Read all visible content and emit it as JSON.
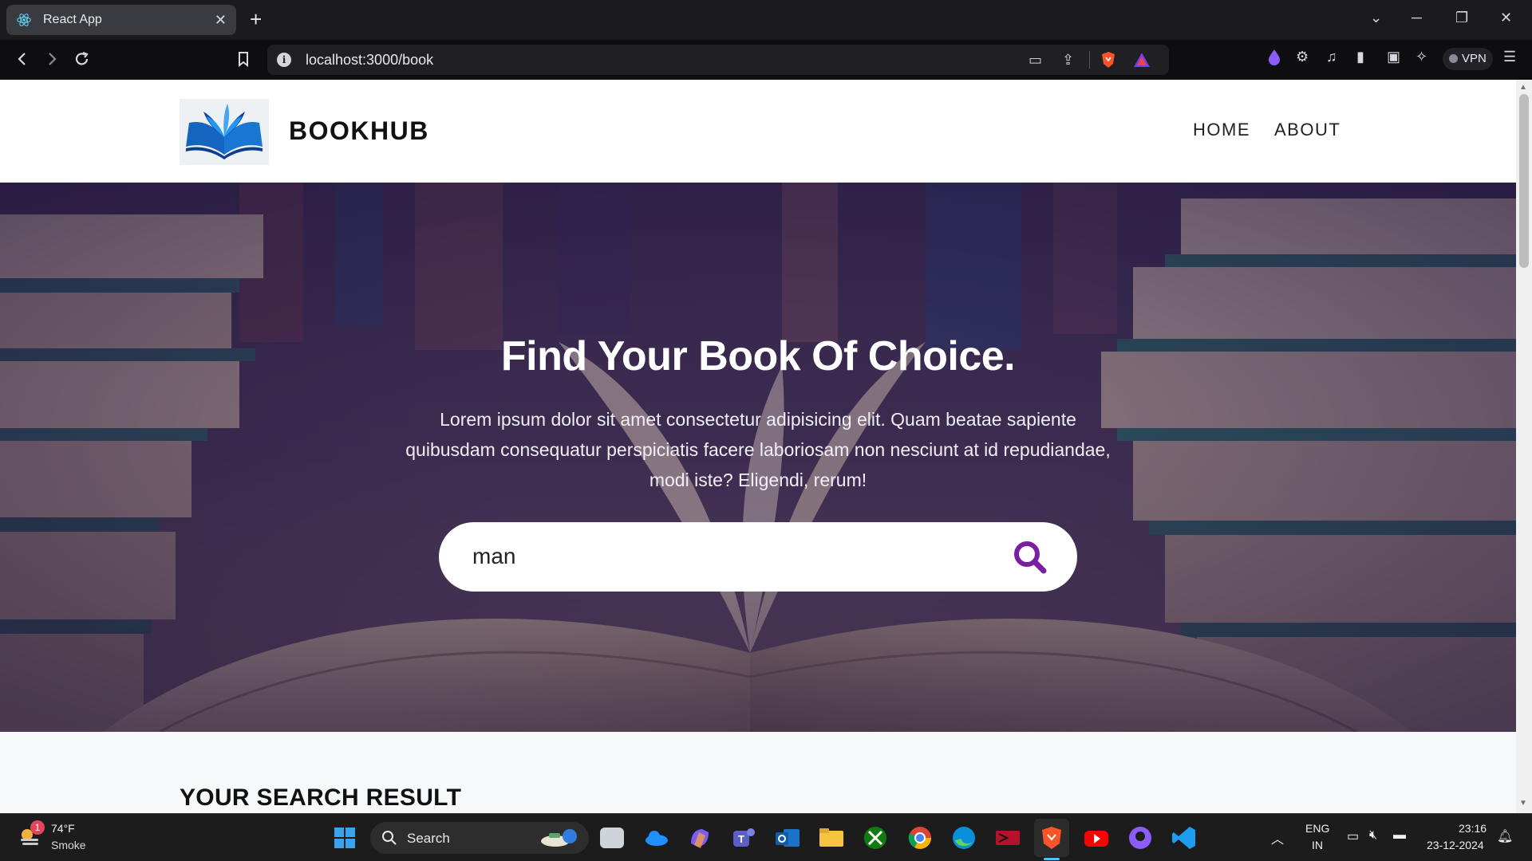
{
  "browser": {
    "tab_title": "React App",
    "url": "localhost:3000/book",
    "vpn_label": "VPN"
  },
  "site": {
    "brand": "BOOKHUB",
    "nav": [
      {
        "label": "HOME"
      },
      {
        "label": "ABOUT"
      }
    ],
    "hero": {
      "title": "Find Your Book Of Choice.",
      "text": "Lorem ipsum dolor sit amet consectetur adipisicing elit. Quam beatae sapiente quibusdam consequatur perspiciatis facere laboriosam non nesciunt at id repudiandae, modi iste? Eligendi, rerum!",
      "search_value": "man"
    },
    "results_title": "YOUR SEARCH RESULT"
  },
  "taskbar": {
    "weather": {
      "temp": "74°F",
      "condition": "Smoke",
      "badge": "1"
    },
    "search_label": "Search",
    "language": {
      "line1": "ENG",
      "line2": "IN"
    },
    "clock": {
      "time": "23:16",
      "date": "23-12-2024"
    }
  },
  "colors": {
    "accent_search": "#7b1fa2",
    "brand_logo": "#1565c0"
  }
}
